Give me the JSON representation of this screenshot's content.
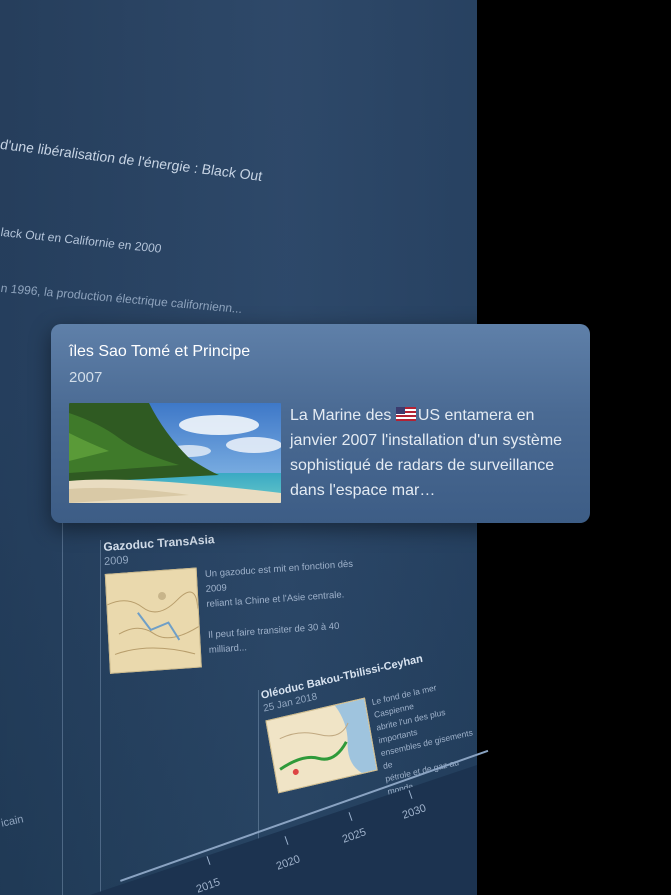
{
  "background_timeline": {
    "heading": "d'une libéralisation de l'énergie : Black Out",
    "subheading": "lack Out en Californie en 2000",
    "line3": "n 1996, la production électrique californienn...",
    "side_text": "icain"
  },
  "popover": {
    "title": "îles Sao Tomé et Principe",
    "date": "2007",
    "body_prefix": "La Marine des ",
    "flag_label": "US",
    "body_rest": " entamera en janvier 2007 l'installation d'un système sophistiqué de radars de surveillance dans l'espace mar…"
  },
  "event_transasia": {
    "title": "Gazoduc TransAsia",
    "date": "2009",
    "line1": "Un gazoduc est mit en fonction dès 2009",
    "line2": "reliant la Chine et l'Asie centrale.",
    "line3": "Il peut faire transiter de 30 à 40 milliard..."
  },
  "event_btc": {
    "title": "Oléoduc Bakou-Tbilissi-Ceyhan",
    "date": "25 Jan 2018",
    "line1": "Le fond de la mer Caspienne",
    "line2": "abrite l'un des plus importants",
    "line3": "ensembles de gisements de",
    "line4": "pétrole et de gaz au monde..."
  },
  "axis": {
    "years": [
      "2015",
      "2020",
      "2025",
      "2030"
    ]
  },
  "colors": {
    "panel": "#294567",
    "card": "#4f6f98",
    "background": "#000000"
  }
}
